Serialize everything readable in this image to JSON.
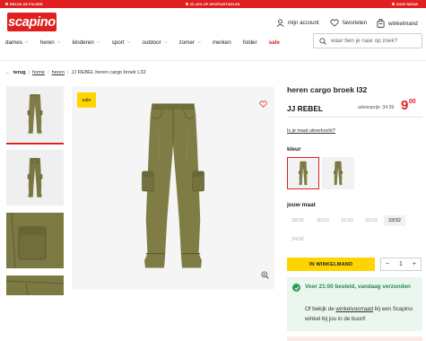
{
  "promo": {
    "left": "BEKIJK DE FOLDER",
    "center": "20–40% OP SPORTARTIKELEN",
    "right": "SHOP NIEUW"
  },
  "header": {
    "logo": "scapino",
    "account": "mijn account",
    "favorites": "favorieten",
    "cart": "winkelmand"
  },
  "nav": {
    "items": [
      {
        "label": "dames",
        "chevron": true
      },
      {
        "label": "heren",
        "chevron": true
      },
      {
        "label": "kinderen",
        "chevron": true
      },
      {
        "label": "sport",
        "chevron": true
      },
      {
        "label": "outdoor",
        "chevron": true
      },
      {
        "label": "zomer",
        "chevron": true
      },
      {
        "label": "merken",
        "chevron": false
      },
      {
        "label": "folder",
        "chevron": false
      },
      {
        "label": "sale",
        "chevron": false
      }
    ],
    "search_placeholder": "waar ben je naar op zoek?"
  },
  "breadcrumb": {
    "back": "terug",
    "home": "home",
    "heren": "heren",
    "current": "JJ REBEL heren cargo broek L32"
  },
  "product": {
    "sale_badge": "sale",
    "title": "heren cargo broek l32",
    "brand": "JJ REBEL",
    "advice_price": "adviesprijs: 34.99",
    "price_int": "9",
    "price_dec": "00",
    "size_advice": "Is je maat uitverkocht?",
    "color_label": "kleur",
    "size_label": "jouw maat",
    "sizes": [
      {
        "label": "28/32",
        "available": false
      },
      {
        "label": "30/32",
        "available": false
      },
      {
        "label": "31/32",
        "available": false
      },
      {
        "label": "32/32",
        "available": false
      },
      {
        "label": "33/32",
        "available": true
      },
      {
        "label": "34/32",
        "available": false
      }
    ],
    "cta": "IN WINKELMAND",
    "qty_minus": "−",
    "qty_value": "1",
    "qty_plus": "+"
  },
  "delivery": {
    "headline": "Voor 21:00 besteld, vandaag verzonden",
    "text_before": "Of bekijk de ",
    "link": "winkelvoorraad",
    "text_after": " bij een Scapino winkel bij jou in de buurt!"
  },
  "colors": {
    "brand_red": "#e0201f",
    "cta_yellow": "#ffd400",
    "pants_olive": "#7f7d45",
    "success_green": "#2f9a52"
  }
}
